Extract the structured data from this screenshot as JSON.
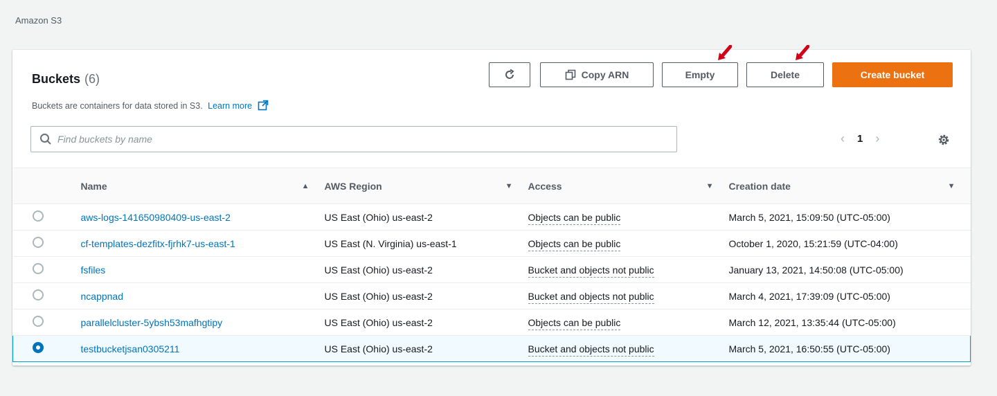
{
  "breadcrumb": "Amazon S3",
  "header": {
    "title": "Buckets",
    "count": "(6)",
    "description": "Buckets are containers for data stored in S3.",
    "learn_more": "Learn more"
  },
  "toolbar": {
    "refresh_icon": "refresh-icon",
    "copy_arn": "Copy ARN",
    "empty": "Empty",
    "delete": "Delete",
    "create_bucket": "Create bucket"
  },
  "search": {
    "placeholder": "Find buckets by name",
    "value": ""
  },
  "pagination": {
    "page": "1"
  },
  "table": {
    "columns": [
      "Name",
      "AWS Region",
      "Access",
      "Creation date"
    ],
    "rows": [
      {
        "name": "aws-logs-141650980409-us-east-2",
        "region": "US East (Ohio) us-east-2",
        "access": "Objects can be public",
        "date": "March 5, 2021, 15:09:50 (UTC-05:00)",
        "selected": false
      },
      {
        "name": "cf-templates-dezfitx-fjrhk7-us-east-1",
        "region": "US East (N. Virginia) us-east-1",
        "access": "Objects can be public",
        "date": "October 1, 2020, 15:21:59 (UTC-04:00)",
        "selected": false
      },
      {
        "name": "fsfiles",
        "region": "US East (Ohio) us-east-2",
        "access": "Bucket and objects not public",
        "date": "January 13, 2021, 14:50:08 (UTC-05:00)",
        "selected": false
      },
      {
        "name": "ncappnad",
        "region": "US East (Ohio) us-east-2",
        "access": "Bucket and objects not public",
        "date": "March 4, 2021, 17:39:09 (UTC-05:00)",
        "selected": false
      },
      {
        "name": "parallelcluster-5ybsh53mafhgtipy",
        "region": "US East (Ohio) us-east-2",
        "access": "Objects can be public",
        "date": "March 12, 2021, 13:35:44 (UTC-05:00)",
        "selected": false
      },
      {
        "name": "testbucketjsan0305211",
        "region": "US East (Ohio) us-east-2",
        "access": "Bucket and objects not public",
        "date": "March 5, 2021, 16:50:55 (UTC-05:00)",
        "selected": true
      }
    ]
  },
  "colors": {
    "accent": "#0073bb",
    "primary_button": "#ec7211",
    "annotation_arrow": "#d0021b"
  }
}
